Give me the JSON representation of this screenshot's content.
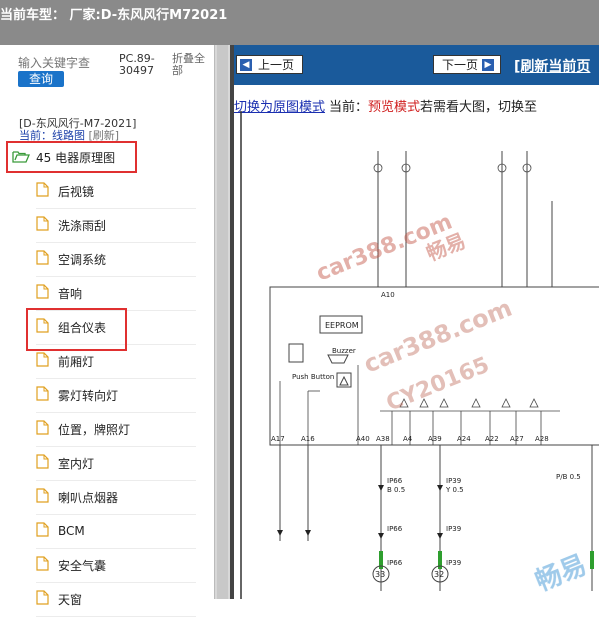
{
  "window": {
    "title": "当前车型： 厂家:D-东风风行M72021"
  },
  "sidebar": {
    "search_placeholder": "输入关键字查",
    "search_button": "查询",
    "pc_code": "PC.89-30497",
    "fold_all": "折叠全部",
    "brand_line": "[D-东风风行-M7-2021]",
    "current_label": "当前：线路图",
    "refresh": "[刷新]",
    "folder": "45 电器原理图",
    "items": [
      {
        "label": "后视镜"
      },
      {
        "label": "洗涤雨刮"
      },
      {
        "label": "空调系统"
      },
      {
        "label": "音响"
      },
      {
        "label": "组合仪表"
      },
      {
        "label": "前厢灯"
      },
      {
        "label": "雾灯转向灯"
      },
      {
        "label": "位置，牌照灯"
      },
      {
        "label": "室内灯"
      },
      {
        "label": "喇叭点烟器"
      },
      {
        "label": "BCM"
      },
      {
        "label": "安全气囊"
      },
      {
        "label": "天窗"
      }
    ]
  },
  "viewer": {
    "prev_button": "上一页",
    "next_button": "下一页",
    "refresh_link": "[刷新当前页",
    "switch_link": "切换为原图模式",
    "current_prefix": "当前：",
    "current_mode": "预览模式",
    "hint": "若需看大图，切换至"
  },
  "diagram_text": {
    "pins": [
      "A10",
      "A17",
      "A16",
      "A40",
      "A38",
      "A4",
      "A39",
      "A24",
      "A22",
      "A27",
      "A28"
    ],
    "blocks": [
      "EEPROM",
      "Buzzer",
      "Push Button"
    ],
    "connectors": [
      "IP39",
      "IP39",
      "IP39",
      "IP39",
      "IP66",
      "IP66",
      "IP66"
    ],
    "nodes": [
      "33",
      "32"
    ],
    "wires": [
      "B 0.5",
      "Y 0.5",
      "P/B 0.5"
    ]
  },
  "watermarks": [
    "car388.com",
    "畅易",
    "car388.com",
    "CY20165",
    "畅易"
  ],
  "colors": {
    "titlebar": "#8a8a8a",
    "navbar": "#1a5a9b",
    "highlight_box": "#e03030",
    "link": "#1a2fb0",
    "mode_red": "#d02020"
  }
}
